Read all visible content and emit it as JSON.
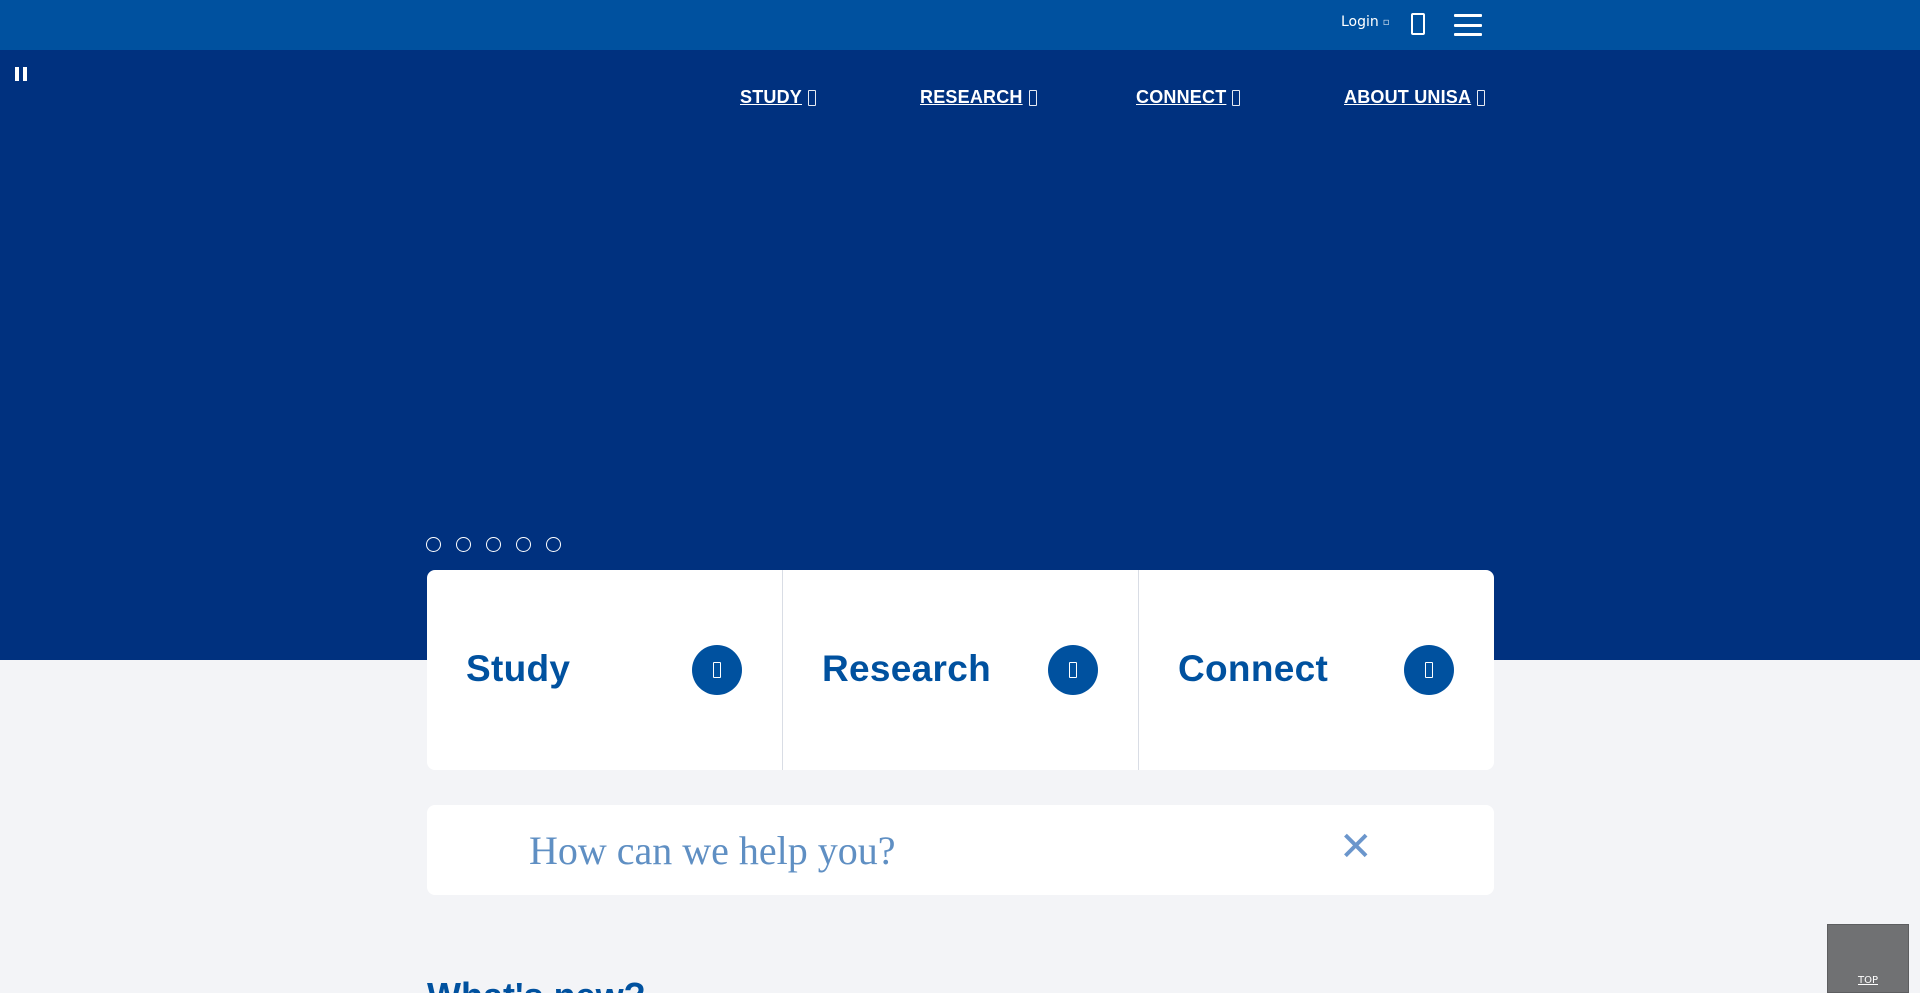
{
  "topbar": {
    "login_label": "Login",
    "login_icon": "external-link-icon",
    "search_icon": "search-icon",
    "menu_icon": "hamburger-menu-icon"
  },
  "hero": {
    "pause_icon": "pause-icon",
    "nav": [
      {
        "label": "STUDY",
        "icon": "chevron-down-icon"
      },
      {
        "label": "RESEARCH",
        "icon": "chevron-down-icon"
      },
      {
        "label": "CONNECT",
        "icon": "chevron-down-icon"
      },
      {
        "label": "ABOUT UNISA",
        "icon": "chevron-down-icon"
      }
    ],
    "slide_count": 5
  },
  "cards": [
    {
      "title": "Study",
      "icon": "arrow-right-icon"
    },
    {
      "title": "Research",
      "icon": "arrow-right-icon"
    },
    {
      "title": "Connect",
      "icon": "arrow-right-icon"
    }
  ],
  "search": {
    "placeholder": "How can we help you?",
    "value": "",
    "clear_label": "✕"
  },
  "section": {
    "whats_new": "What's new?"
  },
  "back_to_top": {
    "label": "TOP"
  },
  "colors": {
    "topbar": "#00519f",
    "hero": "#00317f",
    "accent": "#00519f",
    "page_bg": "#f3f4f7"
  }
}
